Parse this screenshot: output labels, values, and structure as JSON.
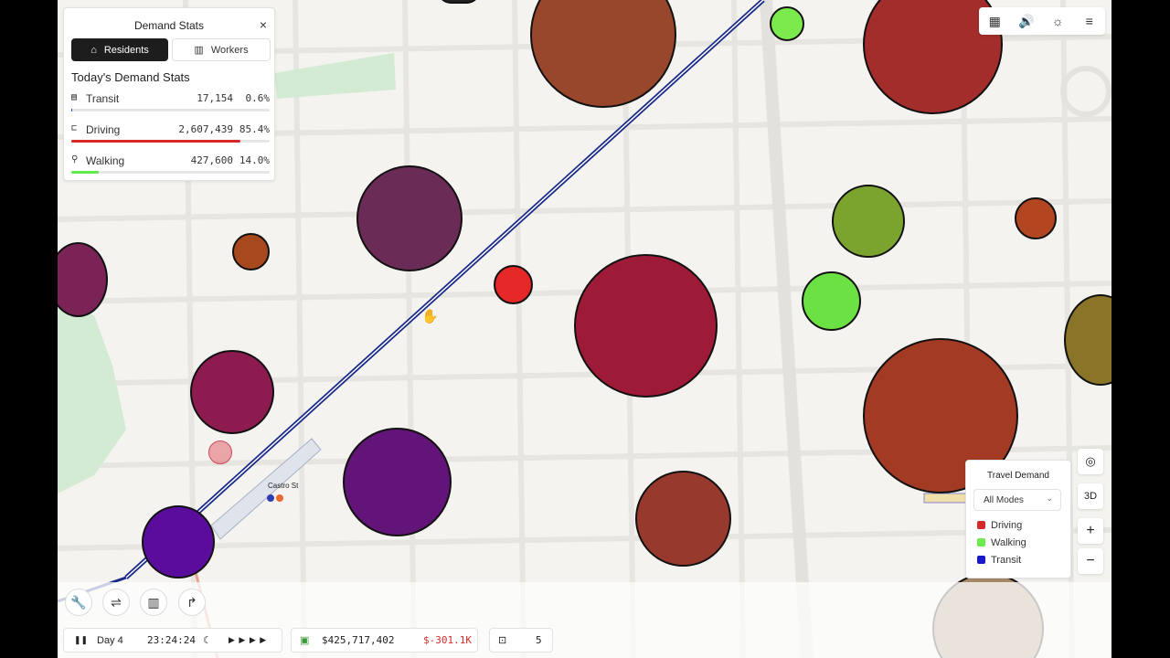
{
  "stats_panel": {
    "title": "Demand Stats",
    "close_icon": "×",
    "tabs": [
      {
        "label": "Residents",
        "icon": "⌂",
        "active": true
      },
      {
        "label": "Workers",
        "icon": "▥",
        "active": false
      }
    ],
    "heading": "Today's Demand Stats",
    "modes": [
      {
        "icon": "▤",
        "label": "Transit",
        "value": "17,154",
        "percent": "0.6%",
        "fraction": 0.006,
        "color": "#1f3cc9"
      },
      {
        "icon": "⊏",
        "label": "Driving",
        "value": "2,607,439",
        "percent": "85.4%",
        "fraction": 0.854,
        "color": "#d42a2a"
      },
      {
        "icon": "⚲",
        "label": "Walking",
        "value": "427,600",
        "percent": "14.0%",
        "fraction": 0.14,
        "color": "#5ee84a"
      }
    ]
  },
  "top_controls": {
    "map_icon": "▦",
    "sound_icon": "🔊",
    "theme_icon": "☼",
    "menu_icon": "≡"
  },
  "map_controls": {
    "compass_icon": "◎",
    "view_3d": "3D",
    "zoom_in": "+",
    "zoom_out": "−"
  },
  "legend": {
    "title": "Travel Demand",
    "select_value": "All Modes",
    "select_chevron": "⌄",
    "items": [
      {
        "label": "Driving",
        "color": "#d42a2a"
      },
      {
        "label": "Walking",
        "color": "#6fea4f"
      },
      {
        "label": "Transit",
        "color": "#1818c8"
      }
    ]
  },
  "map": {
    "station_label": "Castro St",
    "cursor_icon": "✋"
  },
  "toolbar": {
    "tools": [
      "🔧",
      "⇌",
      "▥",
      "↱"
    ]
  },
  "bottom_bar": {
    "pause_icon": "❚❚",
    "day": "Day 4",
    "time": "23:24:24",
    "moon_icon": "☾",
    "speed_icons": "▶ ▶ ▶ ▶",
    "money_icon": "▣",
    "balance": "$425,717,402",
    "delta": "$-301.1K",
    "train_icon": "⊡",
    "train_count": "5"
  },
  "colors": {
    "map_bg": "#f4f3ef",
    "park": "#cfe7cf",
    "rail": "#1a2a8a"
  }
}
